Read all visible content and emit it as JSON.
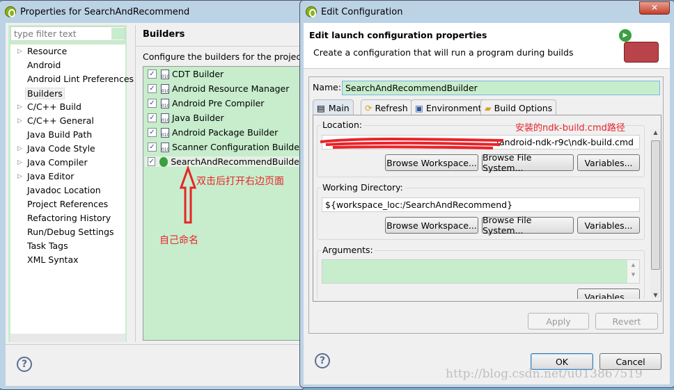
{
  "properties_dialog": {
    "title": "Properties for SearchAndRecommend",
    "filter_placeholder": "type filter text",
    "tree_items": [
      {
        "label": "Resource",
        "expandable": true
      },
      {
        "label": "Android",
        "expandable": false
      },
      {
        "label": "Android Lint Preferences",
        "expandable": false
      },
      {
        "label": "Builders",
        "expandable": false,
        "selected": true
      },
      {
        "label": "C/C++ Build",
        "expandable": true
      },
      {
        "label": "C/C++ General",
        "expandable": true
      },
      {
        "label": "Java Build Path",
        "expandable": false
      },
      {
        "label": "Java Code Style",
        "expandable": true
      },
      {
        "label": "Java Compiler",
        "expandable": true
      },
      {
        "label": "Java Editor",
        "expandable": true
      },
      {
        "label": "Javadoc Location",
        "expandable": false
      },
      {
        "label": "Project References",
        "expandable": false
      },
      {
        "label": "Refactoring History",
        "expandable": false
      },
      {
        "label": "Run/Debug Settings",
        "expandable": false
      },
      {
        "label": "Task Tags",
        "expandable": false
      },
      {
        "label": "XML Syntax",
        "expandable": false
      }
    ],
    "section_title": "Builders",
    "section_desc": "Configure the builders for the project:",
    "builders": [
      {
        "label": "CDT Builder",
        "checked": true
      },
      {
        "label": "Android Resource Manager",
        "checked": true
      },
      {
        "label": "Android Pre Compiler",
        "checked": true
      },
      {
        "label": "Java Builder",
        "checked": true
      },
      {
        "label": "Android Package Builder",
        "checked": true
      },
      {
        "label": "Scanner Configuration Builder",
        "checked": true
      },
      {
        "label": "SearchAndRecommendBuilder",
        "checked": true
      }
    ]
  },
  "annotations": {
    "double_click": "双击后打开右边页面",
    "own_name": "自己命名",
    "ndk_path": "安装的ndk-build.cmd路径"
  },
  "edit_dialog": {
    "title": "Edit Configuration",
    "header_title": "Edit launch configuration properties",
    "header_desc": "Create a configuration that will run a program during builds",
    "name_label": "Name:",
    "name_value": "SearchAndRecommendBuilder",
    "tabs": [
      "Main",
      "Refresh",
      "Environment",
      "Build Options"
    ],
    "active_tab": "Main",
    "location_label": "Location:",
    "location_value": "\\android-ndk-r9c\\ndk-build.cmd",
    "working_dir_label": "Working Directory:",
    "working_dir_value": "${workspace_loc:/SearchAndRecommend}",
    "arguments_label": "Arguments:",
    "browse_workspace": "Browse Workspace...",
    "browse_fs": "Browse File System...",
    "variables": "Variables...",
    "apply": "Apply",
    "revert": "Revert",
    "ok": "OK",
    "cancel": "Cancel",
    "watermark": "http://blog.csdn.net/u013867519"
  },
  "colors": {
    "field_green": "#c7edcc",
    "annotation_red": "#e8242a"
  }
}
